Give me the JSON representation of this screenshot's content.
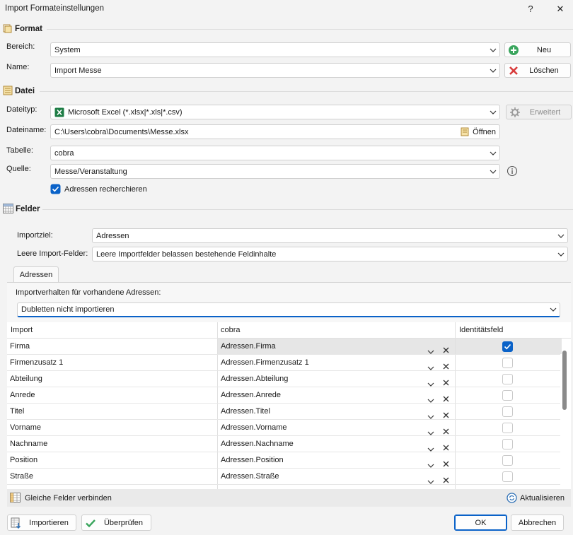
{
  "window": {
    "title": "Import Formateinstellungen",
    "help_label": "?",
    "close_label": "✕"
  },
  "format": {
    "header": "Format",
    "bereich_label": "Bereich:",
    "bereich_value": "System",
    "name_label": "Name:",
    "name_value": "Import Messe",
    "neu_label": "Neu",
    "loeschen_label": "Löschen"
  },
  "datei": {
    "header": "Datei",
    "dateityp_label": "Dateityp:",
    "dateityp_value": "Microsoft Excel (*.xlsx|*.xls|*.csv)",
    "erweitert_label": "Erweitert",
    "dateiname_label": "Dateiname:",
    "dateiname_value": "C:\\Users\\cobra\\Documents\\Messe.xlsx",
    "oeffnen_label": "Öffnen",
    "tabelle_label": "Tabelle:",
    "tabelle_value": "cobra",
    "quelle_label": "Quelle:",
    "quelle_value": "Messe/Veranstaltung",
    "adressen_recherchieren_label": "Adressen recherchieren",
    "adressen_recherchieren_checked": true
  },
  "felder": {
    "header": "Felder",
    "importziel_label": "Importziel:",
    "importziel_value": "Adressen",
    "leere_label": "Leere Import-Felder:",
    "leere_value": "Leere Importfelder belassen bestehende Feldinhalte",
    "tab_label": "Adressen",
    "verhalten_label": "Importverhalten für vorhandene Adressen:",
    "verhalten_value": "Dubletten nicht importieren"
  },
  "grid": {
    "columns": [
      "Import",
      "cobra",
      "Identitätsfeld"
    ],
    "rows": [
      {
        "import": "Firma",
        "cobra": "Adressen.Firma",
        "identity": true
      },
      {
        "import": "Firmenzusatz 1",
        "cobra": "Adressen.Firmenzusatz 1",
        "identity": false
      },
      {
        "import": "Abteilung",
        "cobra": "Adressen.Abteilung",
        "identity": false
      },
      {
        "import": "Anrede",
        "cobra": "Adressen.Anrede",
        "identity": false
      },
      {
        "import": "Titel",
        "cobra": "Adressen.Titel",
        "identity": false
      },
      {
        "import": "Vorname",
        "cobra": "Adressen.Vorname",
        "identity": false
      },
      {
        "import": "Nachname",
        "cobra": "Adressen.Nachname",
        "identity": false
      },
      {
        "import": "Position",
        "cobra": "Adressen.Position",
        "identity": false
      },
      {
        "import": "Straße",
        "cobra": "Adressen.Straße",
        "identity": false
      }
    ]
  },
  "footer": {
    "gleiche_felder_label": "Gleiche Felder verbinden",
    "aktualisieren_label": "Aktualisieren",
    "importieren_label": "Importieren",
    "pruefen_label": "Überprüfen",
    "ok_label": "OK",
    "abbrechen_label": "Abbrechen"
  },
  "colors": {
    "accent": "#0a62c8",
    "add_green": "#3aa55d",
    "delete_red": "#d83b3b"
  }
}
